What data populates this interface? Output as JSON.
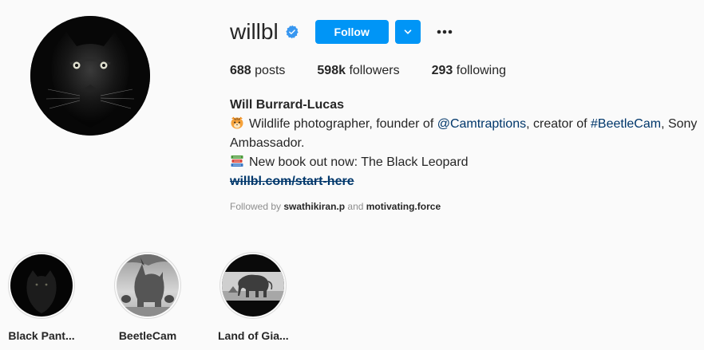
{
  "profile": {
    "username": "willbl",
    "follow_label": "Follow",
    "icons": {
      "verified": "verified-badge-icon",
      "dropdown": "chevron-down-icon",
      "more": "more-options-icon",
      "avatar": "black-leopard-avatar"
    },
    "accent_color": "#0095f6"
  },
  "stats": {
    "posts_count": "688",
    "posts_label": "posts",
    "followers_count": "598k",
    "followers_label": "followers",
    "following_count": "293",
    "following_label": "following"
  },
  "bio": {
    "full_name": "Will Burrard-Lucas",
    "line1_prefix": "Wildlife photographer, founder of ",
    "line1_mention": "@Camtraptions",
    "line1_middle": ", creator of ",
    "line1_hashtag": "#BeetleCam",
    "line1_suffix": ", Sony",
    "line2": "Ambassador.",
    "line3": "New book out now: The Black Leopard",
    "website": "willbl.com/start-here",
    "line1_emoji": "tiger-face-emoji",
    "line3_emoji": "books-emoji"
  },
  "followed_by": {
    "prefix": "Followed by ",
    "user1": "swathikiran.p",
    "joiner": " and ",
    "user2": "motivating.force"
  },
  "highlights": [
    {
      "label": "Black Pant...",
      "thumbnail": "black-panther-thumbnail"
    },
    {
      "label": "BeetleCam",
      "thumbnail": "rhino-thumbnail"
    },
    {
      "label": "Land of Gia...",
      "thumbnail": "elephant-thumbnail"
    }
  ]
}
